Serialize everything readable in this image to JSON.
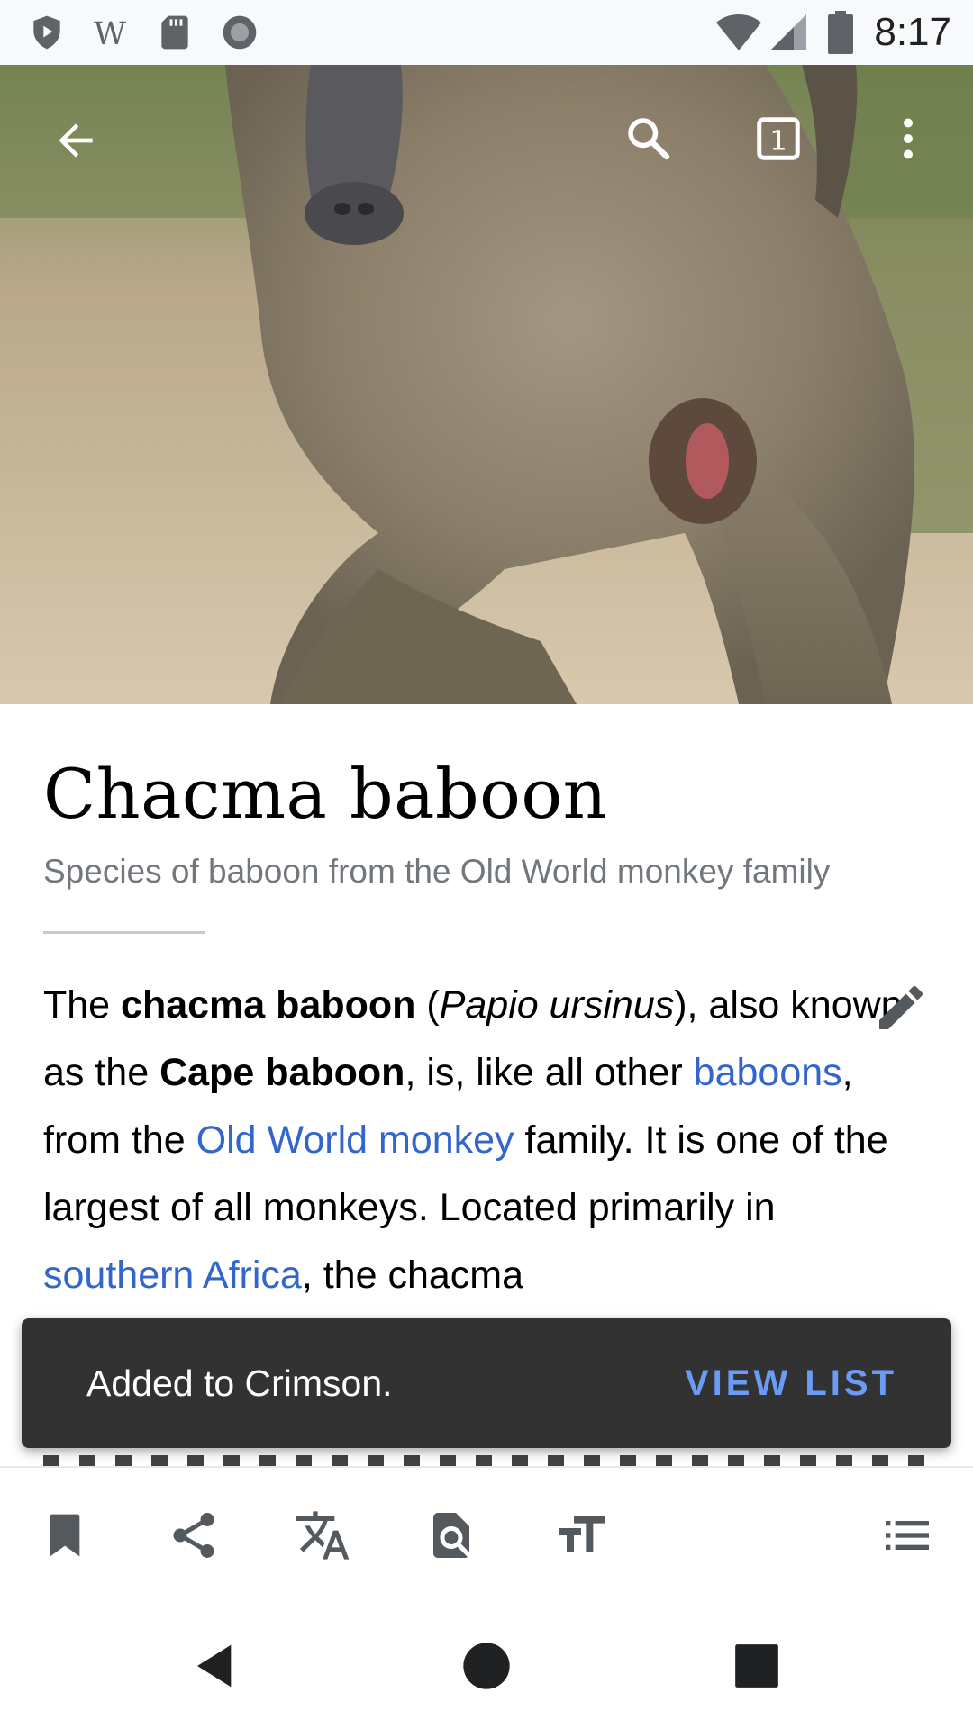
{
  "status_bar": {
    "time": "8:17",
    "left_icons": [
      "play-protect-icon",
      "wikipedia-icon",
      "sd-card-icon",
      "record-icon"
    ],
    "right_icons": [
      "wifi-icon",
      "signal-icon",
      "battery-icon"
    ]
  },
  "toolbar": {
    "icons": [
      "back-arrow-icon",
      "search-icon",
      "tabs-icon",
      "overflow-menu-icon"
    ],
    "tab_count": "1"
  },
  "article": {
    "title": "Chacma baboon",
    "description": "Species of baboon from the Old World monkey family",
    "lead": {
      "t1": "The ",
      "b1": "chacma baboon",
      "t2": " (",
      "i1": "Papio ursinus",
      "t3": "), also known as the ",
      "b2": "Cape baboon",
      "t4": ", is, like all other ",
      "link1": "baboons",
      "t5": ", from the ",
      "link2": "Old World monkey",
      "t6": " family. It is one of the largest of all monkeys. Located primarily in ",
      "link3": "southern Africa",
      "t7": ", the chacma"
    },
    "link_color": "#3366cc"
  },
  "snackbar": {
    "message": "Added to Crimson.",
    "action": "VIEW LIST",
    "action_color": "#6b9cf5"
  },
  "action_bar": {
    "icons": [
      "bookmark-icon",
      "share-icon",
      "translate-icon",
      "find-in-page-icon",
      "text-size-icon",
      "table-of-contents-icon"
    ]
  },
  "nav_bar": {
    "icons": [
      "nav-back-icon",
      "nav-home-icon",
      "nav-recents-icon"
    ]
  }
}
